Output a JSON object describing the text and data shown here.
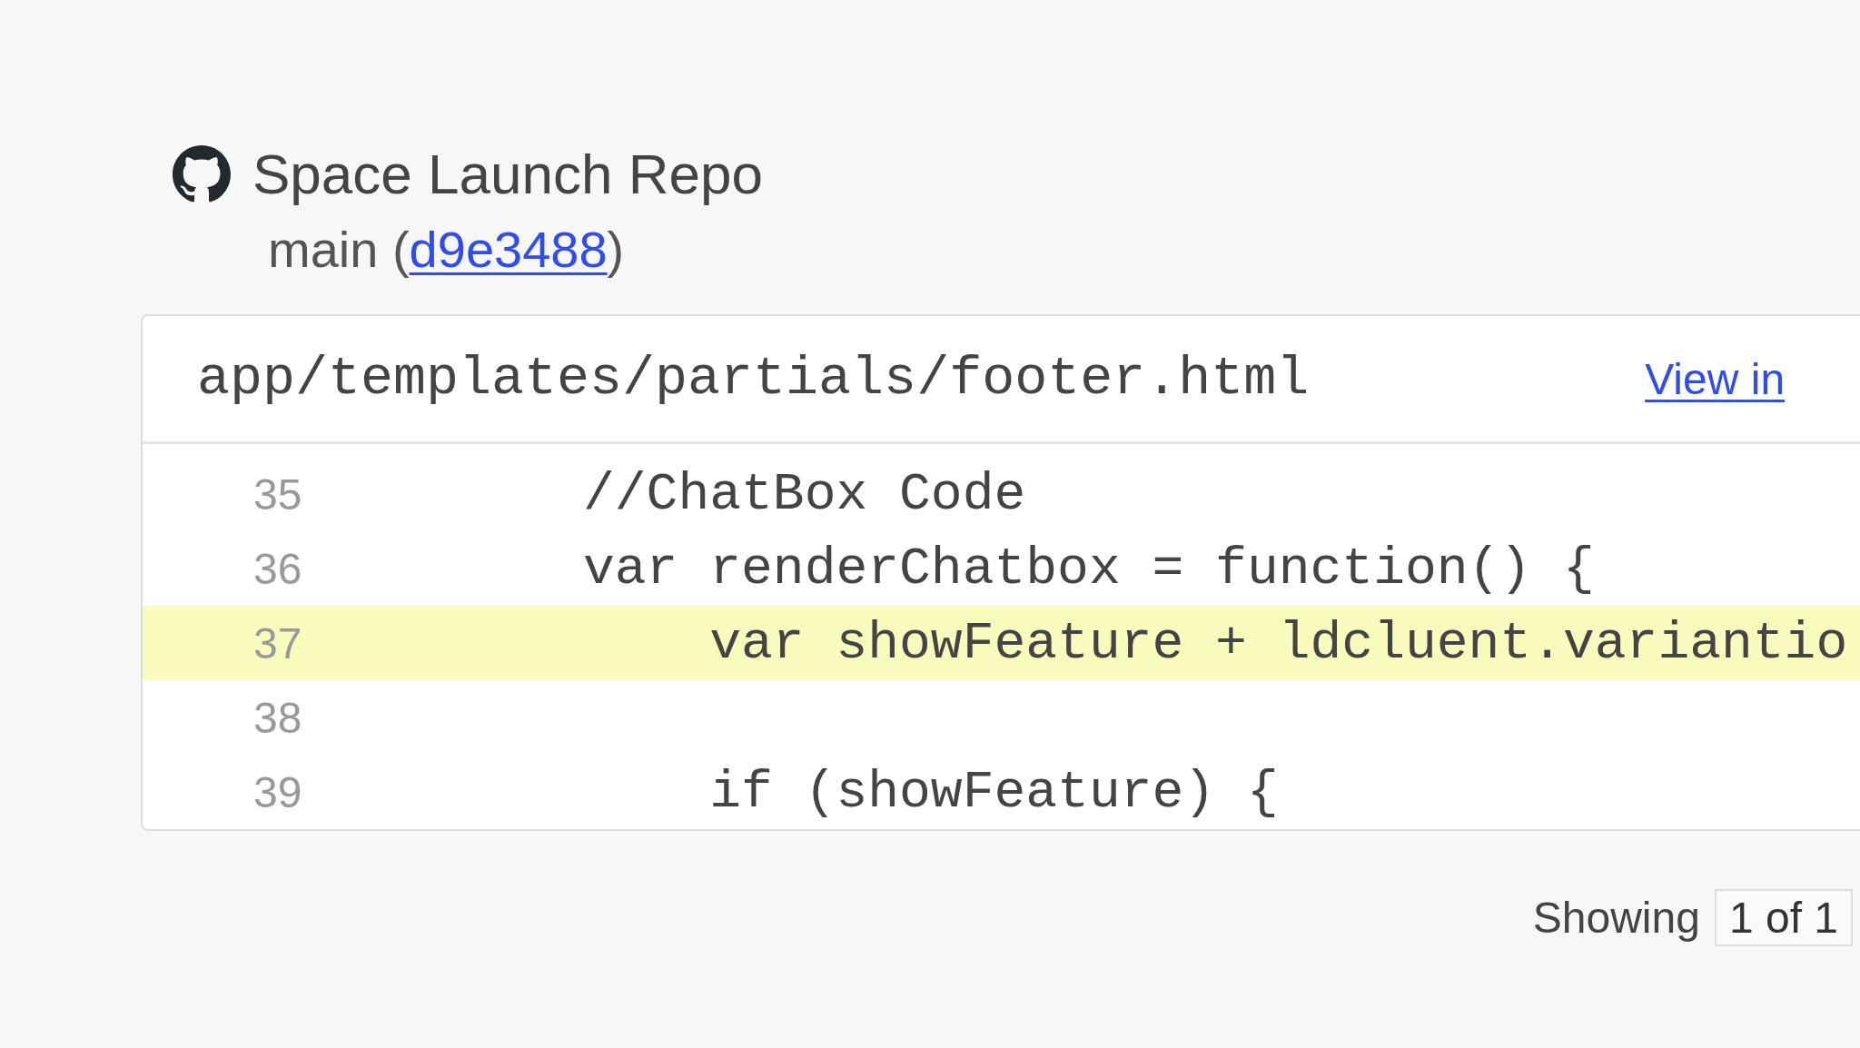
{
  "repo": {
    "name": "Space Launch Repo",
    "branch_prefix": "main (",
    "commit": "d9e3488",
    "branch_suffix": ")"
  },
  "file": {
    "path": "app/templates/partials/footer.html",
    "link": "View in"
  },
  "lines": [
    {
      "number": "35",
      "code": "//ChatBox Code",
      "highlighted": false
    },
    {
      "number": "36",
      "code": "var renderChatbox = function() {",
      "highlighted": false
    },
    {
      "number": "37",
      "code": "    var showFeature + ldcluent.variantio",
      "highlighted": true
    },
    {
      "number": "38",
      "highlighted": false
    },
    {
      "number": "39",
      "code": "    if (showFeature) {",
      "highlighted": false
    }
  ],
  "footer": {
    "label": "Showing",
    "count": "1 of 1"
  }
}
